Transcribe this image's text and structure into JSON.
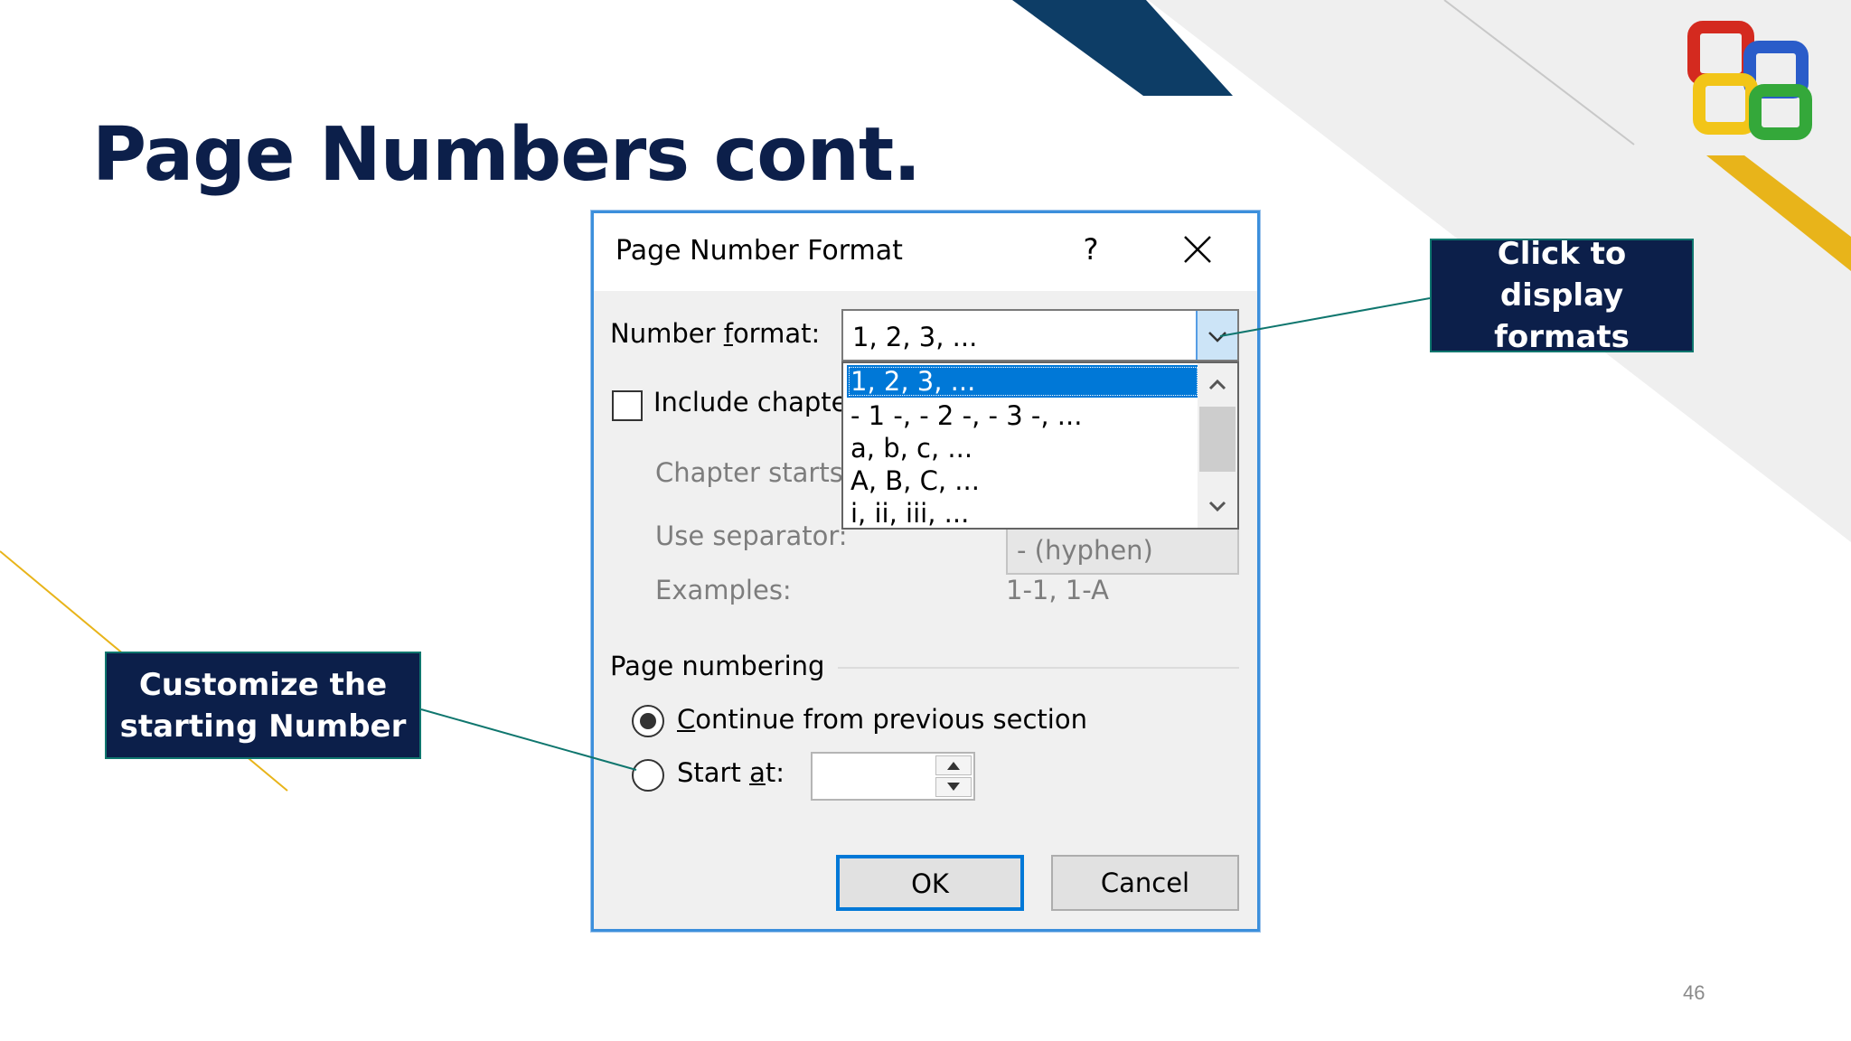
{
  "slide": {
    "title": "Page Numbers cont.",
    "page_number": "46"
  },
  "callouts": {
    "right_line1": "Click to display",
    "right_line2": "formats",
    "left_line1": "Customize the",
    "left_line2": "starting Number"
  },
  "dialog": {
    "title": "Page Number Format",
    "help_label": "?",
    "number_format_label_pre": "Number ",
    "number_format_label_u": "f",
    "number_format_label_post": "ormat:",
    "number_format_value": "1, 2, 3, ...",
    "format_options": [
      "1, 2, 3, ...",
      "- 1 -, - 2 -, - 3 -, ...",
      "a, b, c, ...",
      "A, B, C, ...",
      "i, ii, iii, ..."
    ],
    "include_chapter_label": "Include chapte",
    "chapter_starts_label": "Chapter starts",
    "use_separator_label": "Use separator:",
    "separator_value": "-   (hyphen)",
    "examples_label": "Examples:",
    "examples_value": "1-1, 1-A",
    "page_numbering_label": "Page numbering",
    "continue_u": "C",
    "continue_rest": "ontinue from previous section",
    "start_at_pre": "Start ",
    "start_at_u": "a",
    "start_at_post": "t:",
    "start_at_value": "",
    "ok_label": "OK",
    "cancel_label": "Cancel"
  },
  "colors": {
    "title_navy": "#0c1f4a",
    "dialog_border": "#3c8fdc",
    "selection_blue": "#0078d7",
    "accent_gold": "#e8b41a",
    "accent_navy": "#0d3d66"
  }
}
